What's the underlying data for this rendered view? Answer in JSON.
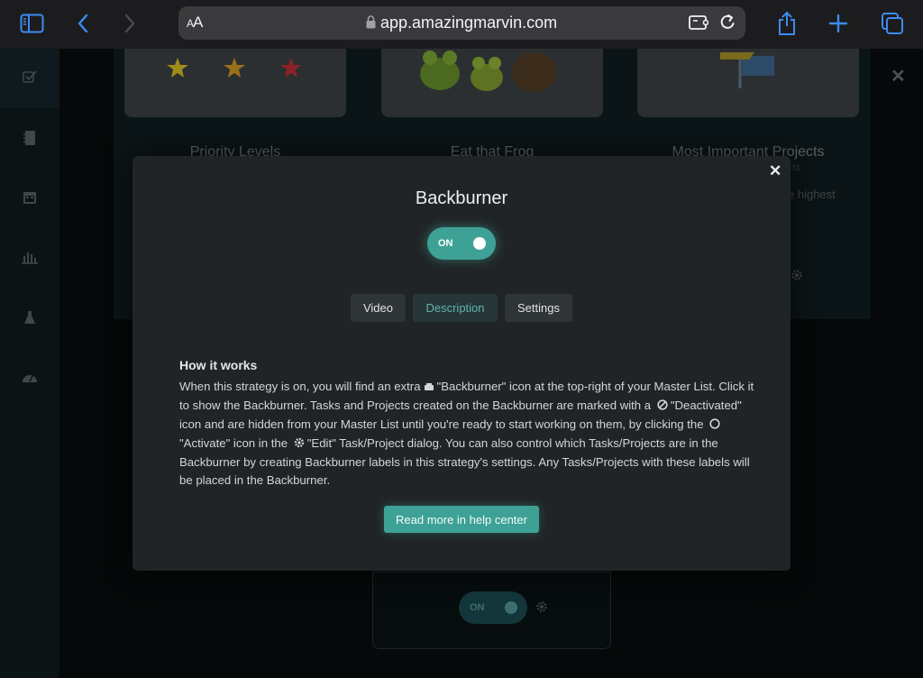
{
  "browser": {
    "address_aa": "AA",
    "url": "app.amazingmarvin.com"
  },
  "sidebar": {
    "items": [
      {
        "icon": "checkbox-icon"
      },
      {
        "icon": "notebook-icon"
      },
      {
        "icon": "calendar-icon"
      },
      {
        "icon": "bar-chart-icon"
      },
      {
        "icon": "flask-icon"
      },
      {
        "icon": "dashboard-icon"
      }
    ]
  },
  "background": {
    "cards": [
      {
        "title": "Priority Levels"
      },
      {
        "title": "Eat that Frog"
      },
      {
        "title": "Most Important Projects"
      }
    ],
    "partial_text_1": "ects",
    "partial_text_2": "e highest",
    "bottom_toggle_label": "ON"
  },
  "modal": {
    "title": "Backburner",
    "toggle_label": "ON",
    "tabs": [
      {
        "label": "Video",
        "active": false
      },
      {
        "label": "Description",
        "active": true
      },
      {
        "label": "Settings",
        "active": false
      }
    ],
    "heading": "How it works",
    "desc": {
      "s1": "When this strategy is on, you will find an extra",
      "s2": "\"Backburner\" icon at the top-right of your Master List. Click it to show the Backburner. Tasks and Projects created on the Backburner are marked with a",
      "s3": "\"Deactivated\" icon and are hidden from your Master List until you're ready to start working on them, by clicking the",
      "s4": "\"Activate\" icon in the",
      "s5": "\"Edit\" Task/Project dialog. You can also control which Tasks/Projects are in the Backburner by creating Backburner labels in this strategy's settings. Any Tasks/Projects with these labels will be placed in the Backburner."
    },
    "help_button": "Read more in help center"
  },
  "colors": {
    "accent": "#3ea196",
    "modal_bg": "#212426",
    "page_bg": "#060909"
  }
}
